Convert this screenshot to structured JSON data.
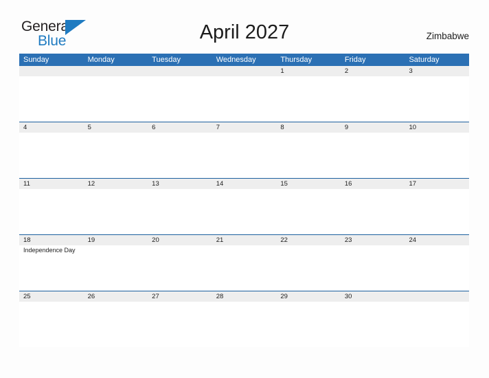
{
  "brand": {
    "name_part1": "General",
    "name_part2": "Blue",
    "flag_icon": "flag-triangle-icon",
    "color_primary": "#1f7bc1",
    "color_text": "#231f20"
  },
  "header": {
    "title": "April 2027",
    "country": "Zimbabwe"
  },
  "calendar": {
    "header_bg": "#2b70b4",
    "header_text": "#ffffff",
    "row_border": "#1b5f9e",
    "date_band_bg": "#eeeeee",
    "weekdays": [
      "Sunday",
      "Monday",
      "Tuesday",
      "Wednesday",
      "Thursday",
      "Friday",
      "Saturday"
    ],
    "weeks": [
      {
        "days": [
          {
            "num": "",
            "event": ""
          },
          {
            "num": "",
            "event": ""
          },
          {
            "num": "",
            "event": ""
          },
          {
            "num": "",
            "event": ""
          },
          {
            "num": "1",
            "event": ""
          },
          {
            "num": "2",
            "event": ""
          },
          {
            "num": "3",
            "event": ""
          }
        ]
      },
      {
        "days": [
          {
            "num": "4",
            "event": ""
          },
          {
            "num": "5",
            "event": ""
          },
          {
            "num": "6",
            "event": ""
          },
          {
            "num": "7",
            "event": ""
          },
          {
            "num": "8",
            "event": ""
          },
          {
            "num": "9",
            "event": ""
          },
          {
            "num": "10",
            "event": ""
          }
        ]
      },
      {
        "days": [
          {
            "num": "11",
            "event": ""
          },
          {
            "num": "12",
            "event": ""
          },
          {
            "num": "13",
            "event": ""
          },
          {
            "num": "14",
            "event": ""
          },
          {
            "num": "15",
            "event": ""
          },
          {
            "num": "16",
            "event": ""
          },
          {
            "num": "17",
            "event": ""
          }
        ]
      },
      {
        "days": [
          {
            "num": "18",
            "event": "Independence Day"
          },
          {
            "num": "19",
            "event": ""
          },
          {
            "num": "20",
            "event": ""
          },
          {
            "num": "21",
            "event": ""
          },
          {
            "num": "22",
            "event": ""
          },
          {
            "num": "23",
            "event": ""
          },
          {
            "num": "24",
            "event": ""
          }
        ]
      },
      {
        "days": [
          {
            "num": "25",
            "event": ""
          },
          {
            "num": "26",
            "event": ""
          },
          {
            "num": "27",
            "event": ""
          },
          {
            "num": "28",
            "event": ""
          },
          {
            "num": "29",
            "event": ""
          },
          {
            "num": "30",
            "event": ""
          },
          {
            "num": "",
            "event": ""
          }
        ]
      }
    ]
  }
}
